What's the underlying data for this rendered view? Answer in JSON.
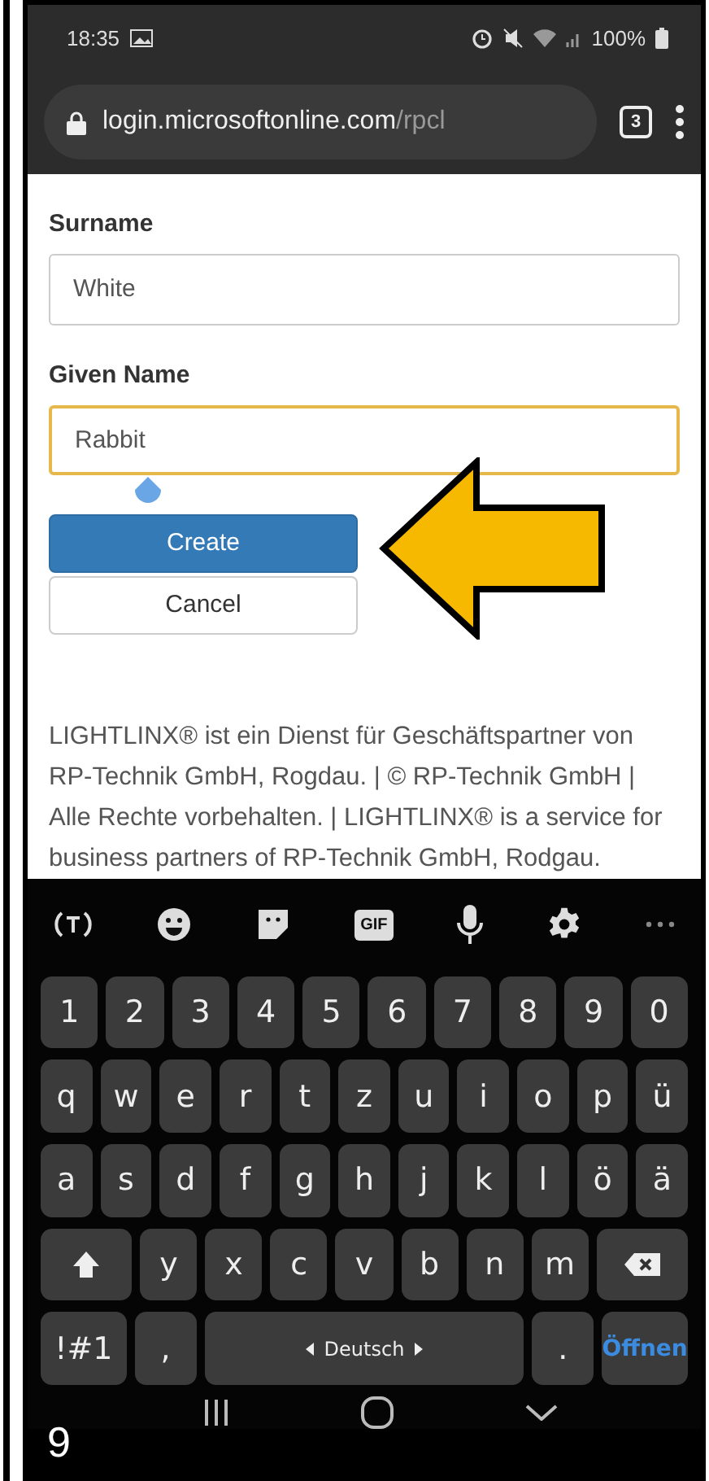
{
  "status_bar": {
    "time": "18:35",
    "battery": "100%"
  },
  "browser": {
    "url_host": "login.microsoftonline.com",
    "url_path": "/rpcl",
    "tab_count": "3"
  },
  "form": {
    "fields": [
      {
        "label": "Surname",
        "value": "White",
        "focused": false
      },
      {
        "label": "Given Name",
        "value": "Rabbit",
        "focused": true
      }
    ],
    "buttons": [
      {
        "label": "Create",
        "kind": "primary"
      },
      {
        "label": "Cancel",
        "kind": "secondary"
      }
    ]
  },
  "footer": "LIGHTLINX® ist ein Dienst für Geschäftspartner von RP-Technik GmbH, Rogdau. | © RP-Technik GmbH | Alle Rechte vorbehalten. | LIGHTLINX® is a service for business partners of RP-Technik GmbH, Rodgau.",
  "keyboard": {
    "gif_label": "GIF",
    "number_keys": [
      "1",
      "2",
      "3",
      "4",
      "5",
      "6",
      "7",
      "8",
      "9",
      "0"
    ],
    "letter_rows": [
      [
        "q",
        "w",
        "e",
        "r",
        "t",
        "z",
        "u",
        "i",
        "o",
        "p",
        "ü"
      ],
      [
        "a",
        "s",
        "d",
        "f",
        "g",
        "h",
        "j",
        "k",
        "l",
        "ö",
        "ä"
      ],
      [
        "y",
        "x",
        "c",
        "v",
        "b",
        "n",
        "m"
      ]
    ],
    "symbols_key": "!#1",
    "comma_key": ",",
    "space_label": "Deutsch",
    "period_key": ".",
    "action_key": "Öffnen"
  },
  "step_number": "9"
}
